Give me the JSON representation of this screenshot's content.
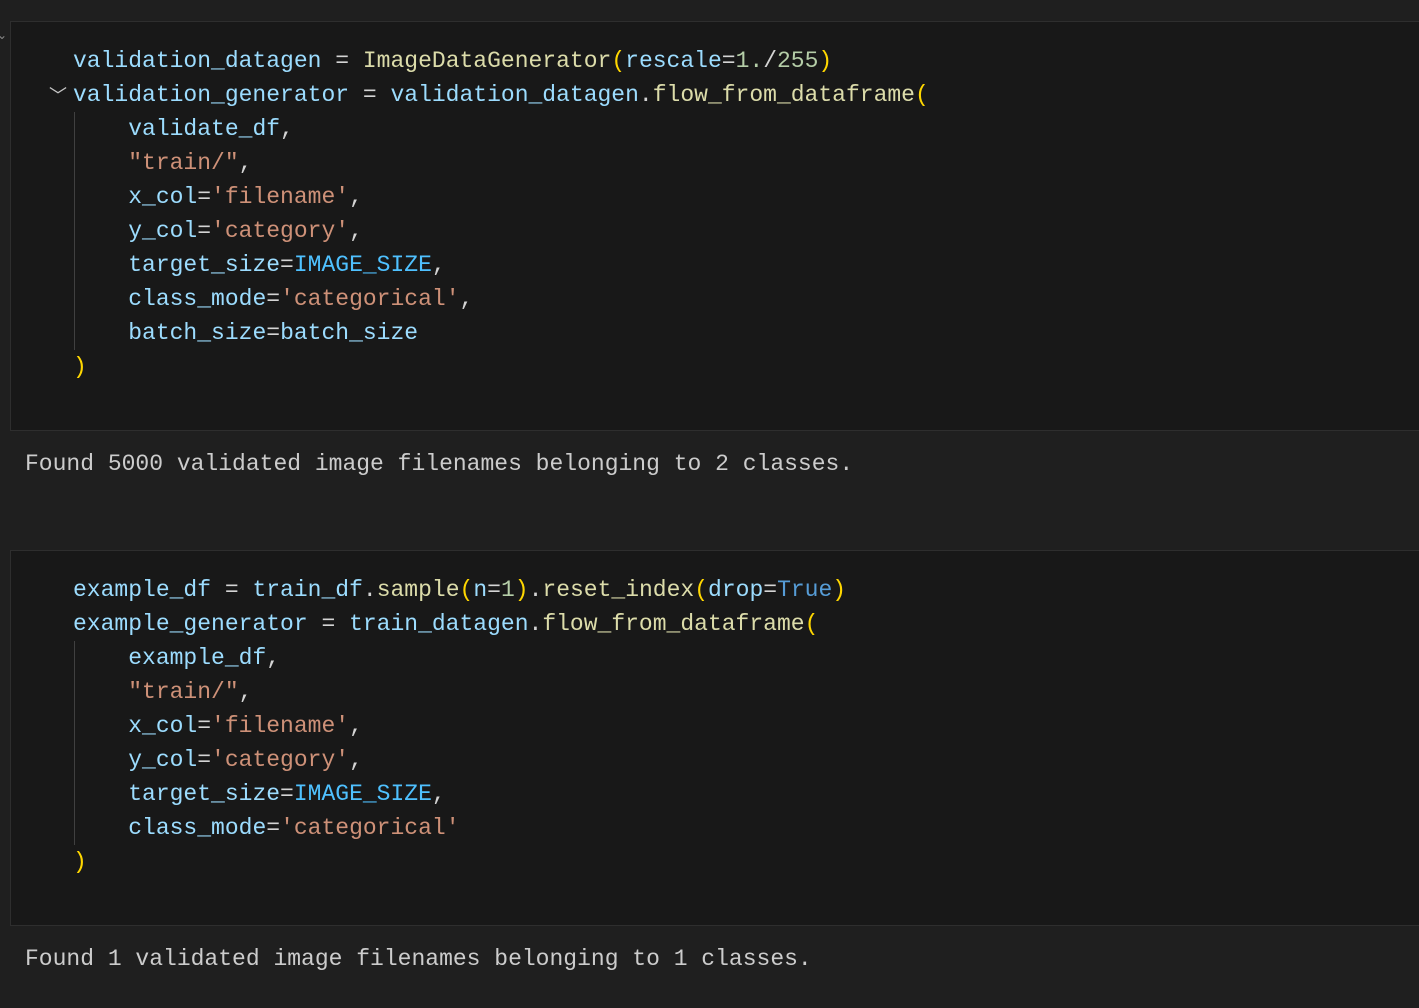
{
  "cells": [
    {
      "lines": [
        [
          [
            "validation_datagen",
            "var"
          ],
          [
            " = ",
            "op"
          ],
          [
            "ImageDataGenerator",
            "fn"
          ],
          [
            "(",
            "br"
          ],
          [
            "rescale",
            "var"
          ],
          [
            "=",
            "op"
          ],
          [
            "1.",
            "num"
          ],
          [
            "/",
            "op"
          ],
          [
            "255",
            "num"
          ],
          [
            ")",
            "br"
          ]
        ],
        [
          [
            "validation_generator",
            "var"
          ],
          [
            " = ",
            "op"
          ],
          [
            "validation_datagen",
            "var"
          ],
          [
            ".",
            "op"
          ],
          [
            "flow_from_dataframe",
            "fn"
          ],
          [
            "(",
            "br"
          ]
        ],
        [
          [
            "    ",
            "op"
          ],
          [
            "validate_df",
            "var"
          ],
          [
            ",",
            "op"
          ]
        ],
        [
          [
            "    ",
            "op"
          ],
          [
            "\"train/\"",
            "str"
          ],
          [
            ",",
            "op"
          ]
        ],
        [
          [
            "    ",
            "op"
          ],
          [
            "x_col",
            "var"
          ],
          [
            "=",
            "op"
          ],
          [
            "'filename'",
            "str"
          ],
          [
            ",",
            "op"
          ]
        ],
        [
          [
            "    ",
            "op"
          ],
          [
            "y_col",
            "var"
          ],
          [
            "=",
            "op"
          ],
          [
            "'category'",
            "str"
          ],
          [
            ",",
            "op"
          ]
        ],
        [
          [
            "    ",
            "op"
          ],
          [
            "target_size",
            "var"
          ],
          [
            "=",
            "op"
          ],
          [
            "IMAGE_SIZE",
            "const"
          ],
          [
            ",",
            "op"
          ]
        ],
        [
          [
            "    ",
            "op"
          ],
          [
            "class_mode",
            "var"
          ],
          [
            "=",
            "op"
          ],
          [
            "'categorical'",
            "str"
          ],
          [
            ",",
            "op"
          ]
        ],
        [
          [
            "    ",
            "op"
          ],
          [
            "batch_size",
            "var"
          ],
          [
            "=",
            "op"
          ],
          [
            "batch_size",
            "var"
          ]
        ],
        [
          [
            ")",
            "br"
          ]
        ]
      ],
      "output": "Found 5000 validated image filenames belonging to 2 classes."
    },
    {
      "lines": [
        [
          [
            "example_df",
            "var"
          ],
          [
            " = ",
            "op"
          ],
          [
            "train_df",
            "var"
          ],
          [
            ".",
            "op"
          ],
          [
            "sample",
            "fn"
          ],
          [
            "(",
            "br"
          ],
          [
            "n",
            "var"
          ],
          [
            "=",
            "op"
          ],
          [
            "1",
            "num"
          ],
          [
            ")",
            "br"
          ],
          [
            ".",
            "op"
          ],
          [
            "reset_index",
            "fn"
          ],
          [
            "(",
            "br"
          ],
          [
            "drop",
            "var"
          ],
          [
            "=",
            "op"
          ],
          [
            "True",
            "kw"
          ],
          [
            ")",
            "br"
          ]
        ],
        [
          [
            "example_generator",
            "var"
          ],
          [
            " = ",
            "op"
          ],
          [
            "train_datagen",
            "var"
          ],
          [
            ".",
            "op"
          ],
          [
            "flow_from_dataframe",
            "fn"
          ],
          [
            "(",
            "br"
          ]
        ],
        [
          [
            "    ",
            "op"
          ],
          [
            "example_df",
            "var"
          ],
          [
            ",",
            "op"
          ]
        ],
        [
          [
            "    ",
            "op"
          ],
          [
            "\"train/\"",
            "str"
          ],
          [
            ",",
            "op"
          ]
        ],
        [
          [
            "    ",
            "op"
          ],
          [
            "x_col",
            "var"
          ],
          [
            "=",
            "op"
          ],
          [
            "'filename'",
            "str"
          ],
          [
            ",",
            "op"
          ]
        ],
        [
          [
            "    ",
            "op"
          ],
          [
            "y_col",
            "var"
          ],
          [
            "=",
            "op"
          ],
          [
            "'category'",
            "str"
          ],
          [
            ",",
            "op"
          ]
        ],
        [
          [
            "    ",
            "op"
          ],
          [
            "target_size",
            "var"
          ],
          [
            "=",
            "op"
          ],
          [
            "IMAGE_SIZE",
            "const"
          ],
          [
            ",",
            "op"
          ]
        ],
        [
          [
            "    ",
            "op"
          ],
          [
            "class_mode",
            "var"
          ],
          [
            "=",
            "op"
          ],
          [
            "'categorical'",
            "str"
          ]
        ],
        [
          [
            ")",
            "br"
          ]
        ]
      ],
      "output": "Found 1 validated image filenames belonging to 1 classes."
    }
  ],
  "colors": {
    "background": "#1f1f1f",
    "cell": "#181818",
    "variable": "#9cdcfe",
    "function": "#dcdcaa",
    "string": "#ce9178",
    "number": "#b5cea8",
    "bracket": "#ffd700",
    "keyword": "#569cd6"
  },
  "icons": {
    "fold": "chevron-down-icon"
  }
}
